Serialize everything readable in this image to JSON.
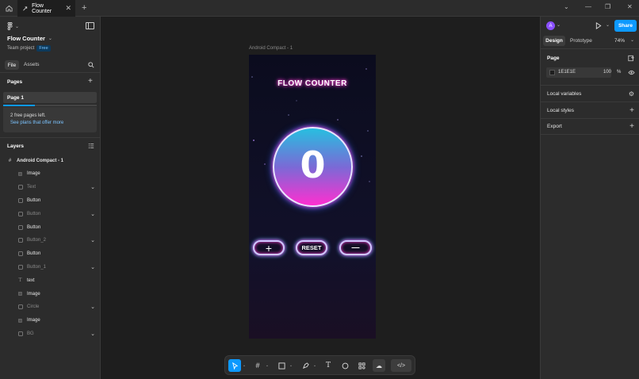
{
  "tabbar": {
    "tab_title": "Flow Counter",
    "close": "✕",
    "new_tab": "+"
  },
  "left": {
    "file_name": "Flow Counter",
    "team": "Team project",
    "plan_badge": "Free",
    "tabs": [
      "File",
      "Assets"
    ],
    "pages_title": "Pages",
    "page_item": "Page 1",
    "notice_line1": "2 free pages left.",
    "notice_link": "See plans that offer more",
    "layers_title": "Layers",
    "layers": [
      {
        "label": "Android Compact - 1",
        "icon": "frame-icon",
        "chev": false,
        "dim": false
      },
      {
        "label": "Image",
        "icon": "image-icon",
        "chev": false,
        "dim": false
      },
      {
        "label": "Text",
        "icon": "frame-icon",
        "chev": true,
        "dim": true
      },
      {
        "label": "Button",
        "icon": "frame-icon",
        "chev": false,
        "dim": false
      },
      {
        "label": "Button",
        "icon": "frame-icon",
        "chev": true,
        "dim": true
      },
      {
        "label": "Button",
        "icon": "frame-icon",
        "chev": false,
        "dim": false
      },
      {
        "label": "Button_2",
        "icon": "frame-icon",
        "chev": true,
        "dim": true
      },
      {
        "label": "Button",
        "icon": "frame-icon",
        "chev": false,
        "dim": false
      },
      {
        "label": "Button_1",
        "icon": "frame-icon",
        "chev": true,
        "dim": true
      },
      {
        "label": "text",
        "icon": "text-icon",
        "chev": false,
        "dim": false
      },
      {
        "label": "Image",
        "icon": "image-icon",
        "chev": false,
        "dim": false
      },
      {
        "label": "Circle",
        "icon": "frame-icon",
        "chev": true,
        "dim": true
      },
      {
        "label": "Image",
        "icon": "image-icon",
        "chev": false,
        "dim": false
      },
      {
        "label": "BG",
        "icon": "frame-icon",
        "chev": true,
        "dim": true
      }
    ]
  },
  "canvas": {
    "frame_label": "Android Compact - 1",
    "app_title": "FLOW COUNTER",
    "counter_value": "0",
    "buttons": {
      "plus": "+",
      "reset": "RESET",
      "minus": "—"
    }
  },
  "right": {
    "avatar": "A",
    "share": "Share",
    "tabs": [
      "Design",
      "Prototype"
    ],
    "zoom": "74%",
    "page_title": "Page",
    "bg_hex": "1E1E1E",
    "bg_opacity": "100",
    "percent": "%",
    "sections": [
      "Local variables",
      "Local styles",
      "Export"
    ]
  },
  "help": "?",
  "colors": {
    "panel": "#2c2c2c",
    "canvas": "#1e1e1e",
    "accent": "#0d99ff",
    "neon_pink": "#ff3fd6",
    "neon_cyan": "#2fc9ff"
  }
}
